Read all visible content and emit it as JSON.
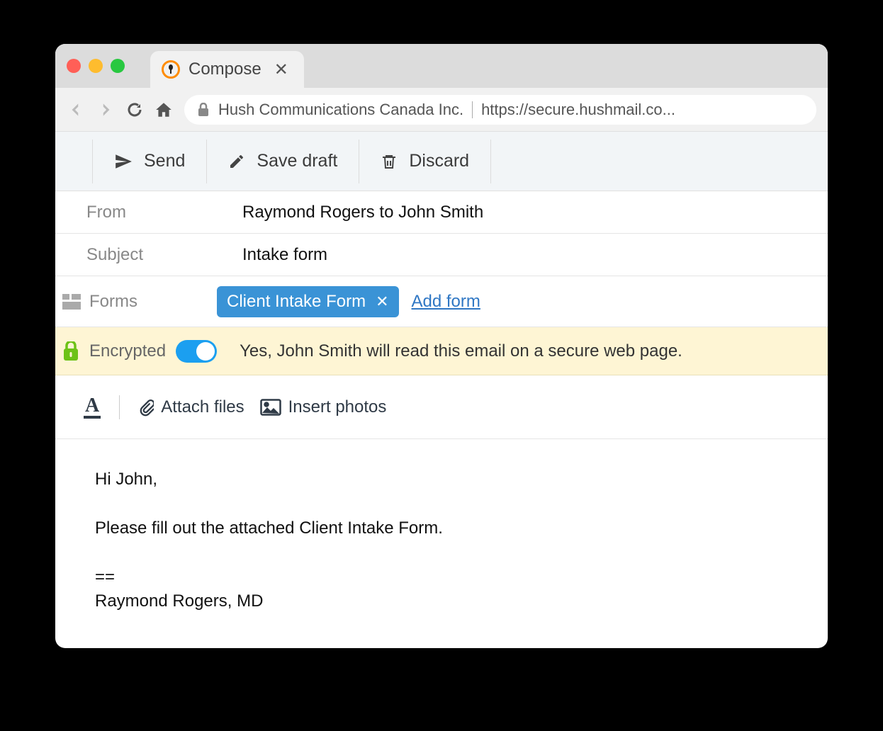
{
  "browser": {
    "tab_title": "Compose",
    "url_org": "Hush Communications Canada Inc.",
    "url_addr": "https://secure.hushmail.co..."
  },
  "actions": {
    "send": "Send",
    "save_draft": "Save draft",
    "discard": "Discard"
  },
  "fields": {
    "from_label": "From",
    "from_value": "Raymond Rogers to John Smith",
    "subject_label": "Subject",
    "subject_value": "Intake form",
    "forms_label": "Forms"
  },
  "forms": {
    "chip": "Client Intake Form",
    "add_form": "Add form"
  },
  "encrypt": {
    "label": "Encrypted",
    "message": "Yes, John Smith will read this email on a secure web page."
  },
  "editor": {
    "attach": "Attach files",
    "insert_photos": "Insert photos"
  },
  "body": {
    "greeting": "Hi John,",
    "line1": "Please fill out the attached Client Intake Form.",
    "sig_sep": "==",
    "signature": "Raymond Rogers, MD"
  }
}
